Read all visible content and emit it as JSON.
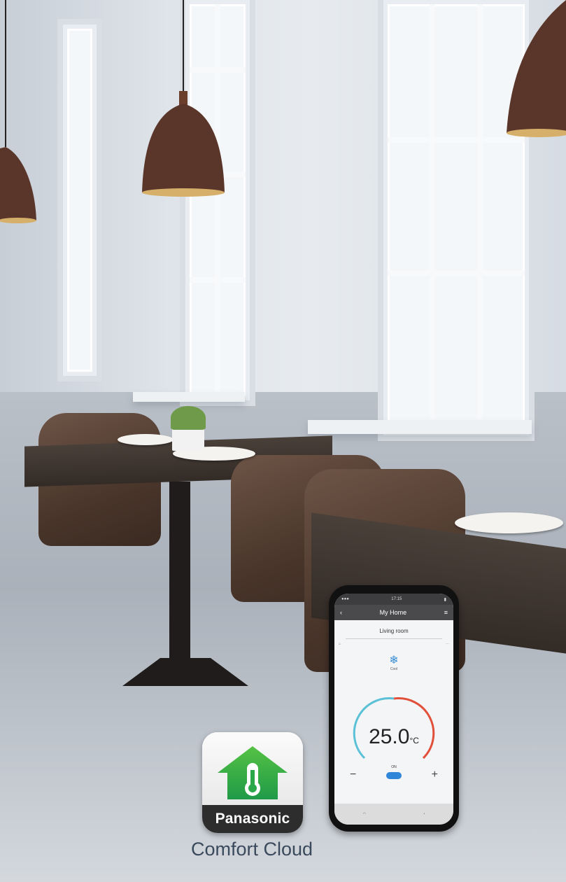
{
  "app": {
    "brand": "Panasonic",
    "name": "Comfort Cloud"
  },
  "phone_screen": {
    "status_time": "17:15",
    "title": "My Home",
    "room": "Living room",
    "mode": "Cool",
    "temperature": "25.0",
    "temperature_unit": "°C",
    "power_label": "ON"
  },
  "colors": {
    "brand_green": "#2aa84a",
    "phone_accent_blue": "#2f86d8",
    "caption_text": "#3a4a5c"
  },
  "icons": {
    "snowflake": "snowflake-icon",
    "house_thermometer": "house-thermometer-icon"
  }
}
